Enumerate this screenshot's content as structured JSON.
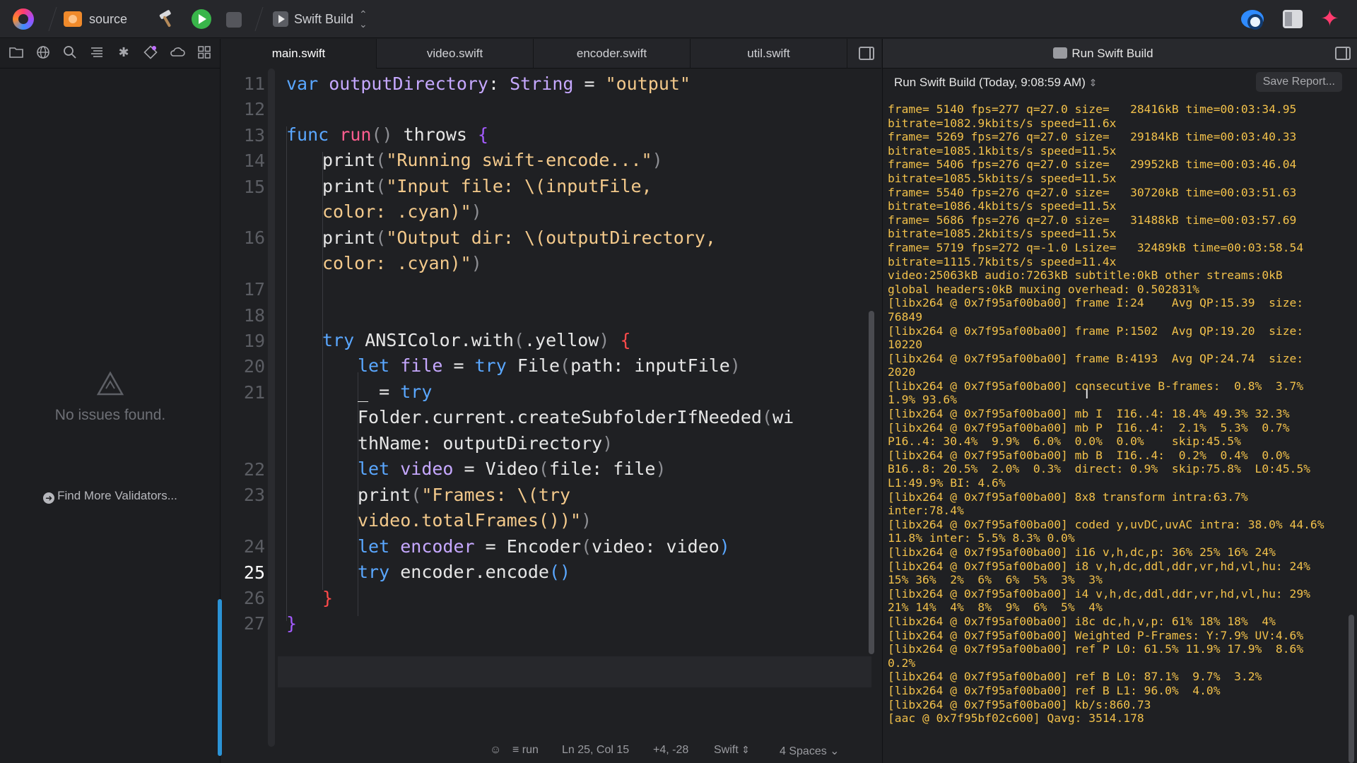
{
  "toolbar": {
    "project": "source",
    "target": "Swift Build"
  },
  "navigator": {
    "message": "No issues found.",
    "find_more": "Find More Validators..."
  },
  "editor": {
    "tabs": [
      "main.swift",
      "video.swift",
      "encoder.swift",
      "util.swift"
    ],
    "active_tab": "main.swift",
    "gutter": [
      {
        "n": "11",
        "y": 0
      },
      {
        "n": "12",
        "y": 1
      },
      {
        "n": "13",
        "y": 2
      },
      {
        "n": "14",
        "y": 3
      },
      {
        "n": "15",
        "y": 4
      },
      {
        "n": "16",
        "y": 6
      },
      {
        "n": "17",
        "y": 8
      },
      {
        "n": "18",
        "y": 9
      },
      {
        "n": "19",
        "y": 10
      },
      {
        "n": "20",
        "y": 11
      },
      {
        "n": "21",
        "y": 12
      },
      {
        "n": "22",
        "y": 15
      },
      {
        "n": "23",
        "y": 16
      },
      {
        "n": "24",
        "y": 18
      },
      {
        "n": "25",
        "y": 19
      },
      {
        "n": "26",
        "y": 20
      },
      {
        "n": "27",
        "y": 21
      }
    ],
    "code": {
      "l1": [
        "var",
        "outputDirectory",
        ": ",
        "String",
        " = ",
        "\"output\""
      ],
      "l3": [
        "func",
        "run",
        "()",
        "throws",
        "{"
      ],
      "l4": [
        "print",
        "(",
        "\"Running swift-encode...\"",
        ")"
      ],
      "l5": [
        "print",
        "(",
        "\"Input file: \\(inputFile,"
      ],
      "l6": [
        "color: .cyan)\"",
        ")"
      ],
      "l7": [
        "print",
        "(",
        "\"Output dir: \\(outputDirectory,"
      ],
      "l8": [
        "color: .cyan)\"",
        ")"
      ],
      "l11": [
        "try",
        "ANSIColor.with",
        "(",
        ".yellow",
        ")",
        "{"
      ],
      "l12": [
        "let",
        "file",
        " = ",
        "try",
        "File",
        "(",
        "path: inputFile",
        ")"
      ],
      "l13": [
        "_",
        " = ",
        "try"
      ],
      "l14": [
        "Folder.current.createSubfolderIfNeeded",
        "(",
        "wi"
      ],
      "l15": [
        "thName: outputDirectory",
        ")"
      ],
      "l16": [
        "let",
        "video",
        " = ",
        "Video",
        "(",
        "file: file",
        ")"
      ],
      "l17": [
        "print",
        "(",
        "\"Frames: \\(try"
      ],
      "l18": [
        "video.totalFrames())\"",
        ")"
      ],
      "l19": [
        "let",
        "encoder",
        " = ",
        "Encoder",
        "(",
        "video: video",
        ")"
      ],
      "l20": [
        "try",
        "encoder.encode",
        "()"
      ],
      "l21": [
        "}"
      ],
      "l22": [
        "}"
      ]
    },
    "status": {
      "scope": "run",
      "position": "Ln 25, Col 15",
      "changes": "+4, -28",
      "language": "Swift",
      "indent": "4 Spaces"
    }
  },
  "console": {
    "title": "Run Swift Build",
    "run_label": "Run Swift Build (Today, 9:08:59 AM)",
    "save_report": "Save Report...",
    "lines": [
      "frame= 5140 fps=277 q=27.0 size=   28416kB time=00:03:34.95",
      "bitrate=1082.9kbits/s speed=11.6x",
      "frame= 5269 fps=276 q=27.0 size=   29184kB time=00:03:40.33",
      "bitrate=1085.1kbits/s speed=11.5x",
      "frame= 5406 fps=276 q=27.0 size=   29952kB time=00:03:46.04",
      "bitrate=1085.5kbits/s speed=11.5x",
      "frame= 5540 fps=276 q=27.0 size=   30720kB time=00:03:51.63",
      "bitrate=1086.4kbits/s speed=11.5x",
      "frame= 5686 fps=276 q=27.0 size=   31488kB time=00:03:57.69",
      "bitrate=1085.2kbits/s speed=11.5x",
      "frame= 5719 fps=272 q=-1.0 Lsize=   32489kB time=00:03:58.54",
      "bitrate=1115.7kbits/s speed=11.4x",
      "video:25063kB audio:7263kB subtitle:0kB other streams:0kB",
      "global headers:0kB muxing overhead: 0.502831%",
      "[libx264 @ 0x7f95af00ba00] frame I:24    Avg QP:15.39  size:",
      "76849",
      "[libx264 @ 0x7f95af00ba00] frame P:1502  Avg QP:19.20  size:",
      "10220",
      "[libx264 @ 0x7f95af00ba00] frame B:4193  Avg QP:24.74  size:",
      "2020",
      "[libx264 @ 0x7f95af00ba00] consecutive B-frames:  0.8%  3.7%",
      "1.9% 93.6%",
      "[libx264 @ 0x7f95af00ba00] mb I  I16..4: 18.4% 49.3% 32.3%",
      "[libx264 @ 0x7f95af00ba00] mb P  I16..4:  2.1%  5.3%  0.7%",
      "P16..4: 30.4%  9.9%  6.0%  0.0%  0.0%    skip:45.5%",
      "[libx264 @ 0x7f95af00ba00] mb B  I16..4:  0.2%  0.4%  0.0%",
      "B16..8: 20.5%  2.0%  0.3%  direct: 0.9%  skip:75.8%  L0:45.5%",
      "L1:49.9% BI: 4.6%",
      "[libx264 @ 0x7f95af00ba00] 8x8 transform intra:63.7%",
      "inter:78.4%",
      "[libx264 @ 0x7f95af00ba00] coded y,uvDC,uvAC intra: 38.0% 44.6%",
      "11.8% inter: 5.5% 8.3% 0.0%",
      "[libx264 @ 0x7f95af00ba00] i16 v,h,dc,p: 36% 25% 16% 24%",
      "[libx264 @ 0x7f95af00ba00] i8 v,h,dc,ddl,ddr,vr,hd,vl,hu: 24%",
      "15% 36%  2%  6%  6%  5%  3%  3%",
      "[libx264 @ 0x7f95af00ba00] i4 v,h,dc,ddl,ddr,vr,hd,vl,hu: 29%",
      "21% 14%  4%  8%  9%  6%  5%  4%",
      "[libx264 @ 0x7f95af00ba00] i8c dc,h,v,p: 61% 18% 18%  4%",
      "[libx264 @ 0x7f95af00ba00] Weighted P-Frames: Y:7.9% UV:4.6%",
      "[libx264 @ 0x7f95af00ba00] ref P L0: 61.5% 11.9% 17.9%  8.6%",
      "0.2%",
      "[libx264 @ 0x7f95af00ba00] ref B L0: 87.1%  9.7%  3.2%",
      "[libx264 @ 0x7f95af00ba00] ref B L1: 96.0%  4.0%",
      "[libx264 @ 0x7f95af00ba00] kb/s:860.73",
      "[aac @ 0x7f95bf02c600] Qavg: 3514.178"
    ]
  }
}
